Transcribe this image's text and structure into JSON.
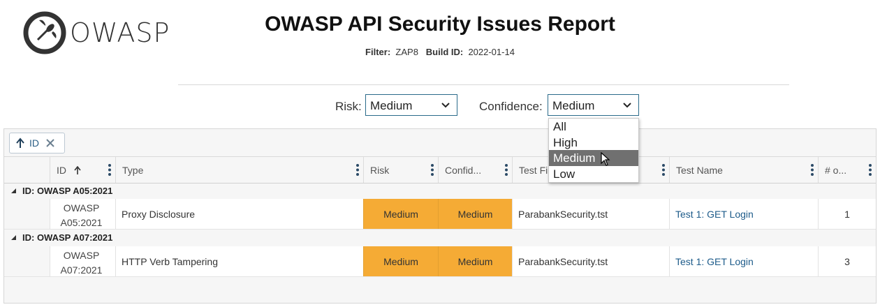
{
  "logo": {
    "text": "OWASP"
  },
  "title": "OWASP API Security Issues Report",
  "filter_line": {
    "filter_label": "Filter:",
    "filter_value": "ZAP8",
    "build_label": "Build ID:",
    "build_value": "2022-01-14"
  },
  "controls": {
    "risk": {
      "label": "Risk:",
      "value": "Medium"
    },
    "confidence": {
      "label": "Confidence:",
      "value": "Medium",
      "options": [
        "All",
        "High",
        "Medium",
        "Low"
      ],
      "highlighted": "Medium"
    }
  },
  "group_chip": {
    "label": "ID"
  },
  "columns": [
    "ID",
    "Type",
    "Risk",
    "Confid...",
    "Test Fi",
    "Test Name",
    "# o..."
  ],
  "groups": [
    {
      "label": "ID: OWASP A05:2021",
      "rows": [
        {
          "id_line1": "OWASP",
          "id_line2": "A05:2021",
          "type": "Proxy Disclosure",
          "risk": "Medium",
          "confidence": "Medium",
          "test_file": "ParabankSecurity.tst",
          "test_name": "Test 1: GET Login",
          "count": "1"
        }
      ]
    },
    {
      "label": "ID: OWASP A07:2021",
      "rows": [
        {
          "id_line1": "OWASP",
          "id_line2": "A07:2021",
          "type": "HTTP Verb Tampering",
          "risk": "Medium",
          "confidence": "Medium",
          "test_file": "ParabankSecurity.tst",
          "test_name": "Test 1: GET Login",
          "count": "3"
        }
      ]
    }
  ],
  "colors": {
    "badge_medium": "#f5ab35",
    "link": "#1d5b8a",
    "select_border": "#2a6a8a",
    "dropdown_highlight": "#707070"
  },
  "icons": {
    "logo": "wasp-logo-icon",
    "sort": "arrow-up-icon",
    "remove": "close-icon",
    "menu": "kebab-icon",
    "expand": "triangle-down-icon",
    "select": "chevron-down-icon",
    "pointer": "mouse-cursor-icon"
  }
}
